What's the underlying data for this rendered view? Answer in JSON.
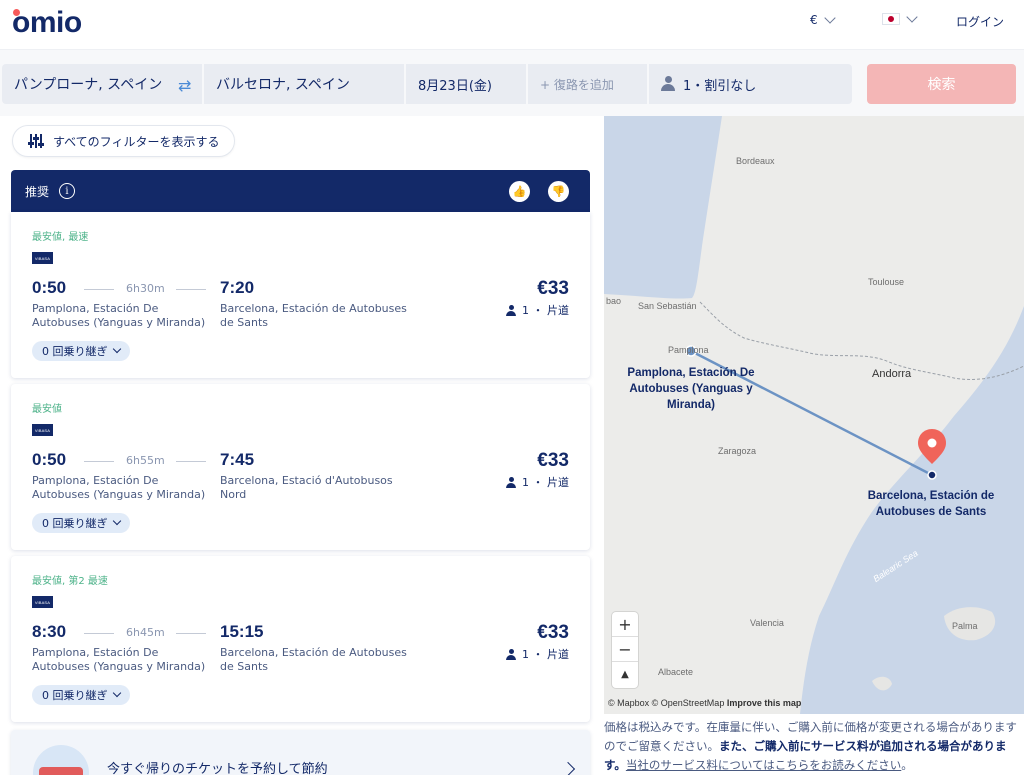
{
  "header": {
    "logo": "omio",
    "currency": "€",
    "login": "ログイン"
  },
  "search": {
    "from": "パンプローナ, スペイン",
    "to": "バルセロナ, スペイン",
    "date": "8月23日(金)",
    "return_placeholder": "+ 復路を追加",
    "passengers": "1・割引なし",
    "search_button": "検索"
  },
  "filters": {
    "label": "すべてのフィルターを表示する"
  },
  "recommended": {
    "label": "推奨",
    "info": "i"
  },
  "results": [
    {
      "tag": "最安値, 最速",
      "carrier": "ViBASA",
      "depart": "0:50",
      "duration": "6h30m",
      "arrive": "7:20",
      "from_station": "Pamplona, Estación De Autobuses (Yanguas y Miranda)",
      "to_station": "Barcelona, Estación de Autobuses de Sants",
      "price": "€33",
      "passengers": "1 ・ 片道",
      "transfers": "0 回乗り継ぎ"
    },
    {
      "tag": "最安値",
      "carrier": "ViBASA",
      "depart": "0:50",
      "duration": "6h55m",
      "arrive": "7:45",
      "from_station": "Pamplona, Estación De Autobuses (Yanguas y Miranda)",
      "to_station": "Barcelona, Estació d'Autobusos Nord",
      "price": "€33",
      "passengers": "1 ・ 片道",
      "transfers": "0 回乗り継ぎ"
    },
    {
      "tag": "最安値, 第2 最速",
      "carrier": "ViBASA",
      "depart": "8:30",
      "duration": "6h45m",
      "arrive": "15:15",
      "from_station": "Pamplona, Estación De Autobuses (Yanguas y Miranda)",
      "to_station": "Barcelona, Estación de Autobuses de Sants",
      "price": "€33",
      "passengers": "1 ・ 片道",
      "transfers": "0 回乗り継ぎ"
    }
  ],
  "promo": {
    "text": "今すぐ帰りのチケットを予約して節約"
  },
  "map": {
    "labels": {
      "bordeaux": "Bordeaux",
      "toulouse": "Toulouse",
      "bao": "bao",
      "san_sebastian": "San Sebastián",
      "pamplona_small": "Pamplona",
      "andorra": "Andorra",
      "zaragoza": "Zaragoza",
      "valencia": "Valencia",
      "palma": "Palma",
      "albacete": "Albacete",
      "balearic_sea": "Balearic Sea"
    },
    "origin_label": "Pamplona, Estación De Autobuses (Yanguas y Miranda)",
    "destination_label": "Barcelona, Estación de Autobuses de Sants",
    "attribution": "© Mapbox © OpenStreetMap",
    "improve": "Improve this map"
  },
  "notice": {
    "text1": "価格は税込みです。在庫量に伴い、ご購入前に価格が変更される場合がありますのでご留意ください。",
    "bold": "また、ご購入前にサービス料が追加される場合があります。",
    "link": "当社のサービス料についてはこちらをお読みください",
    "end": "。"
  },
  "colors": {
    "brand_navy": "#132968",
    "brand_red": "#f65a5a",
    "tag_green": "#4eb38a",
    "search_button_disabled": "#f4b6b6",
    "route_line": "#6c93c4"
  }
}
